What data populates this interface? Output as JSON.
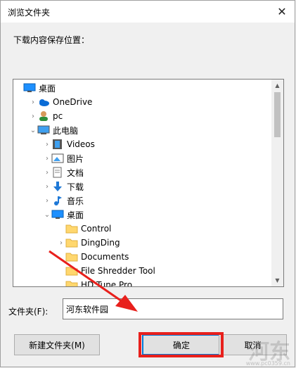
{
  "window": {
    "title": "浏览文件夹",
    "close_glyph": "✕"
  },
  "prompt": "下载内容保存位置：",
  "tree": [
    {
      "label": "桌面",
      "icon": "desktop-icon",
      "expand": "",
      "indent": 0
    },
    {
      "label": "OneDrive",
      "icon": "onedrive-icon",
      "expand": "›",
      "indent": 1
    },
    {
      "label": "pc",
      "icon": "user-icon",
      "expand": "›",
      "indent": 1
    },
    {
      "label": "此电脑",
      "icon": "computer-icon",
      "expand": "⌄",
      "indent": 1
    },
    {
      "label": "Videos",
      "icon": "videos-icon",
      "expand": "›",
      "indent": 2
    },
    {
      "label": "图片",
      "icon": "pictures-icon",
      "expand": "›",
      "indent": 2
    },
    {
      "label": "文档",
      "icon": "documents-icon",
      "expand": "›",
      "indent": 2
    },
    {
      "label": "下载",
      "icon": "downloads-icon",
      "expand": "›",
      "indent": 2
    },
    {
      "label": "音乐",
      "icon": "music-icon",
      "expand": "›",
      "indent": 2
    },
    {
      "label": "桌面",
      "icon": "desktop-icon",
      "expand": "⌄",
      "indent": 2
    },
    {
      "label": "Control",
      "icon": "folder-icon",
      "expand": "",
      "indent": 3
    },
    {
      "label": "DingDing",
      "icon": "folder-icon",
      "expand": "›",
      "indent": 3
    },
    {
      "label": "Documents",
      "icon": "folder-icon",
      "expand": "",
      "indent": 3
    },
    {
      "label": "File Shredder Tool",
      "icon": "folder-icon",
      "expand": "",
      "indent": 3
    },
    {
      "label": "HD Tune Pro",
      "icon": "folder-icon",
      "expand": "",
      "indent": 3
    }
  ],
  "folder_field": {
    "label": "文件夹(F):",
    "value": "河东软件园"
  },
  "buttons": {
    "new_folder": "新建文件夹(M)",
    "ok": "确定",
    "cancel": "取消"
  },
  "watermark": {
    "text": "河东",
    "url": "www.pc0359.cn"
  },
  "colors": {
    "accent": "#0078d7",
    "highlight": "#e8201c",
    "folder": "#ffd76e"
  }
}
